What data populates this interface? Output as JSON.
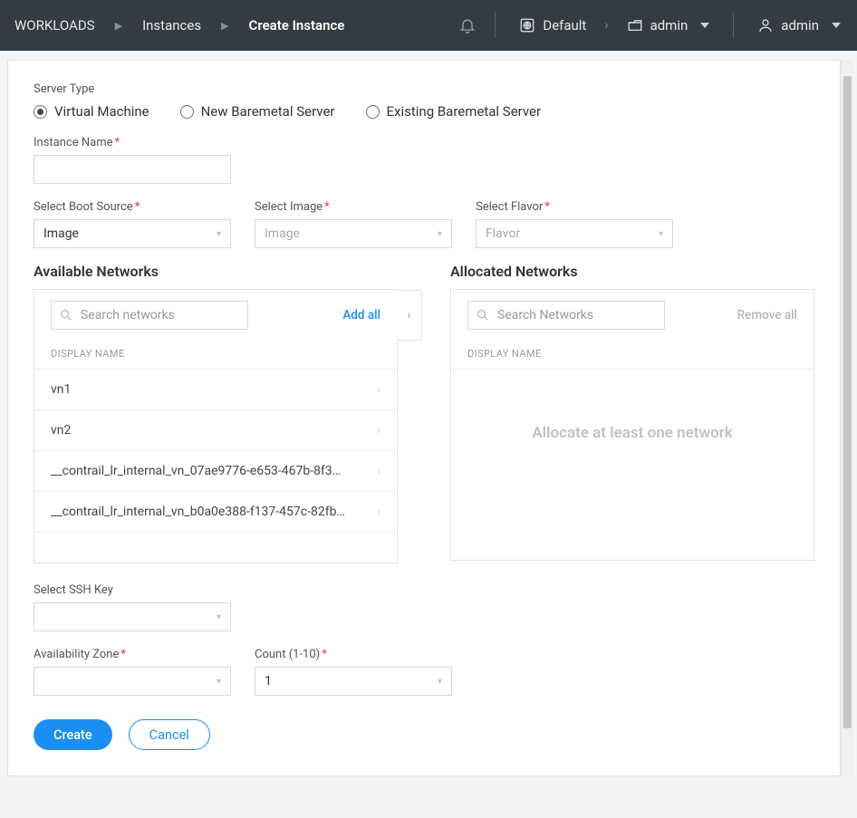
{
  "topbar": {
    "breadcrumb": [
      "WORKLOADS",
      "Instances",
      "Create Instance"
    ],
    "scope_label": "Default",
    "project_label": "admin",
    "user_label": "admin"
  },
  "form": {
    "server_type": {
      "label": "Server Type",
      "options": [
        "Virtual Machine",
        "New Baremetal Server",
        "Existing Baremetal Server"
      ],
      "selected": 0
    },
    "instance_name": {
      "label": "Instance Name",
      "required": true,
      "value": ""
    },
    "boot_source": {
      "label": "Select Boot Source",
      "required": true,
      "value": "Image"
    },
    "image": {
      "label": "Select Image",
      "required": true,
      "placeholder": "Image"
    },
    "flavor": {
      "label": "Select Flavor",
      "required": true,
      "placeholder": "Flavor"
    },
    "available": {
      "title": "Available Networks",
      "search_placeholder": "Search networks",
      "add_all": "Add all",
      "col": "DISPLAY NAME",
      "rows": [
        "vn1",
        "vn2",
        "__contrail_lr_internal_vn_07ae9776-e653-467b-8f3…",
        "__contrail_lr_internal_vn_b0a0e388-f137-457c-82fb…"
      ]
    },
    "allocated": {
      "title": "Allocated Networks",
      "search_placeholder": "Search Networks",
      "remove_all": "Remove all",
      "col": "DISPLAY NAME",
      "empty": "Allocate at least one network"
    },
    "ssh_key": {
      "label": "Select SSH Key",
      "value": ""
    },
    "zone": {
      "label": "Availability Zone",
      "required": true,
      "value": ""
    },
    "count": {
      "label": "Count (1-10)",
      "required": true,
      "value": "1"
    },
    "actions": {
      "create": "Create",
      "cancel": "Cancel"
    }
  }
}
